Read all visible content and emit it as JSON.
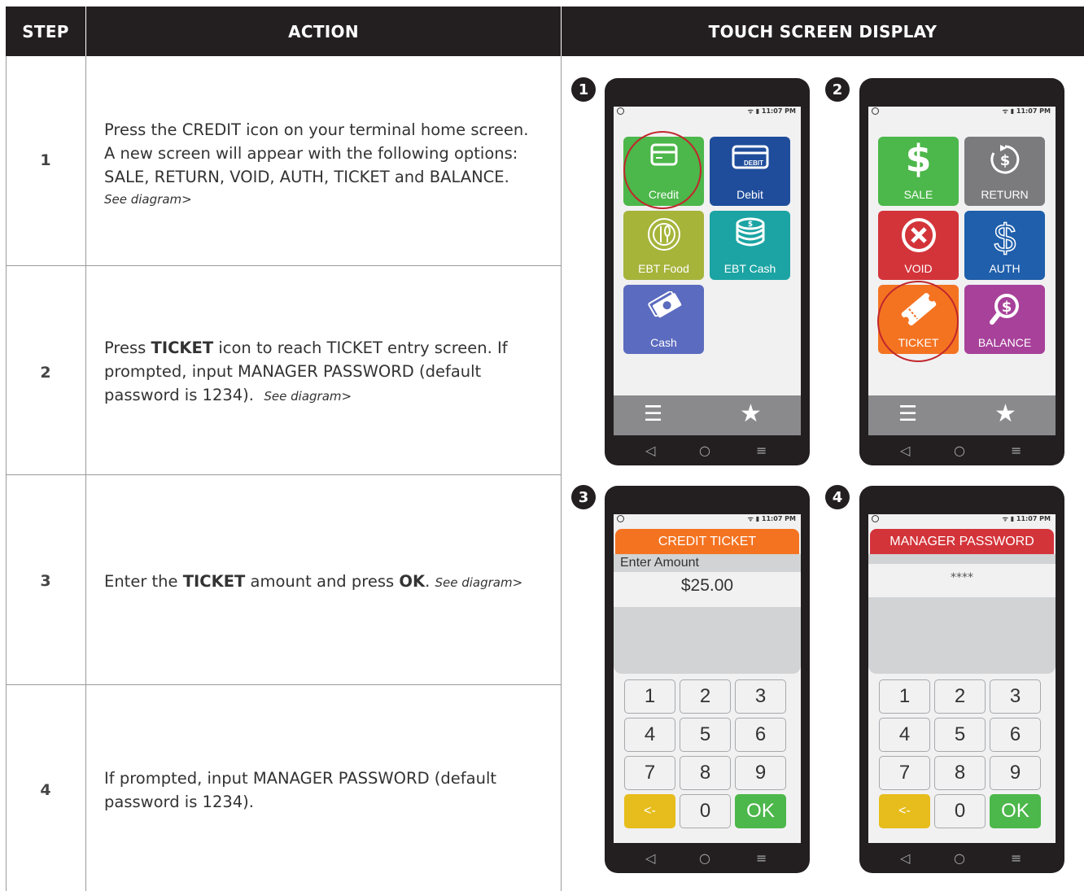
{
  "table": {
    "headers": [
      "STEP",
      "ACTION",
      "TOUCH SCREEN DISPLAY"
    ],
    "rows": [
      {
        "step": "1",
        "lines": [
          "Press the CREDIT icon on your terminal home screen.",
          "A new screen will appear with the following options:",
          "SALE, RETURN, VOID, AUTH, TICKET and BALANCE."
        ],
        "see": "See diagram>"
      },
      {
        "step": "2",
        "press": "Press ",
        "bold1": "TICKET",
        "line1_rest": " icon to reach TICKET entry screen. If",
        "line2": "prompted, input MANAGER PASSWORD (default",
        "line3": "password is 1234).",
        "see": "See diagram>"
      },
      {
        "step": "3",
        "pre": "Enter the ",
        "bold1": "TICKET",
        "mid": " amount and press ",
        "bold2": "OK",
        "post": ".",
        "see": "See diagram>"
      },
      {
        "step": "4",
        "line1": "If prompted, input MANAGER PASSWORD (default",
        "line2": "password is 1234)."
      }
    ]
  },
  "phones": {
    "status_time": "11:07 PM",
    "badges": [
      "1",
      "2",
      "3",
      "4"
    ],
    "home_tiles": [
      {
        "label": "Credit",
        "color": "#4cb74a",
        "icon": "card-icon"
      },
      {
        "label": "Debit",
        "color": "#1f4d9b",
        "icon": "debit-card-icon"
      },
      {
        "label": "EBT Food",
        "color": "#a6b43a",
        "icon": "plate-fork-icon"
      },
      {
        "label": "EBT Cash",
        "color": "#1ba4a3",
        "icon": "coins-icon"
      },
      {
        "label": "Cash",
        "color": "#5b6bbf",
        "icon": "bills-icon"
      }
    ],
    "debit_card_text": "DEBIT",
    "credit_tiles": [
      {
        "label": "SALE",
        "color": "#4cb74a",
        "icon": "dollar-icon"
      },
      {
        "label": "RETURN",
        "color": "#7b7b7d",
        "icon": "return-dollar-icon"
      },
      {
        "label": "VOID",
        "color": "#d3343a",
        "icon": "x-circle-icon"
      },
      {
        "label": "AUTH",
        "color": "#1f5fab",
        "icon": "outline-dollar-icon"
      },
      {
        "label": "TICKET",
        "color": "#f47321",
        "icon": "ticket-icon"
      },
      {
        "label": "BALANCE",
        "color": "#a7419a",
        "icon": "magnify-dollar-icon"
      }
    ],
    "credit_ticket": {
      "title": "CREDIT TICKET",
      "title_color": "#f47321",
      "prompt": "Enter Amount",
      "amount": "$25.00"
    },
    "manager": {
      "title": "MANAGER PASSWORD",
      "title_color": "#d3343a",
      "masked": "****"
    },
    "keypad": [
      "1",
      "2",
      "3",
      "4",
      "5",
      "6",
      "7",
      "8",
      "9",
      "<-",
      "0",
      "OK"
    ],
    "nav_glyphs": [
      "◁",
      "○",
      "≡"
    ]
  }
}
